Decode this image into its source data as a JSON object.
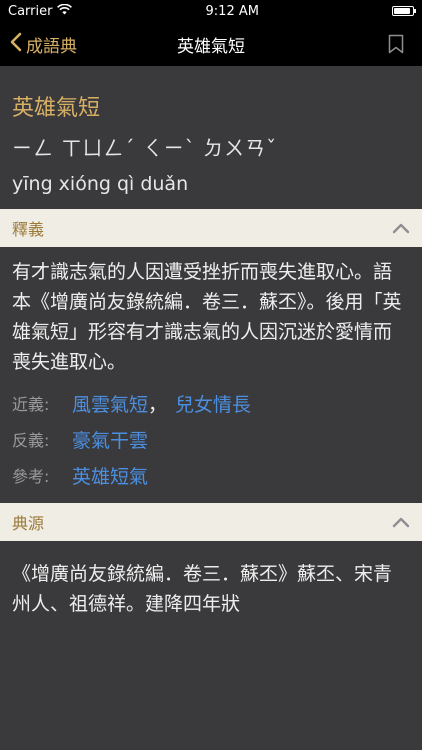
{
  "status": {
    "carrier": "Carrier",
    "time": "9:12 AM",
    "battery_level": 0.9
  },
  "nav": {
    "back_label": "成語典",
    "title": "英雄氣短"
  },
  "entry": {
    "title": "英雄氣短",
    "bopomofo": "ㄧㄥ ㄒㄩㄥˊ ㄑㄧˋ ㄉㄨㄢˇ",
    "pinyin": "yīng xióng qì duǎn"
  },
  "meaning": {
    "header": "釋義",
    "definition": "有才識志氣的人因遭受挫折而喪失進取心。語本《增廣尚友錄統編．卷三．蘇丕》。後用「英雄氣短」形容有才識志氣的人因沉迷於愛情而喪失進取心。",
    "synonyms_label": "近義:",
    "synonyms": [
      "風雲氣短",
      "兒女情長"
    ],
    "synonym_separator": "，",
    "antonyms_label": "反義:",
    "antonyms": [
      "豪氣干雲"
    ],
    "reference_label": "參考:",
    "references": [
      "英雄短氣"
    ]
  },
  "source": {
    "header": "典源",
    "text": "《增廣尚友錄統編．卷三．蘇丕》蘇丕、宋青州人、祖德祥。建降四年狀"
  },
  "colors": {
    "accent": "#d7b065",
    "link": "#4c8fe0",
    "background": "#3a3a3c",
    "section_header_bg": "#efede4"
  },
  "icons": {
    "back": "chevron-left-icon",
    "bookmark": "bookmark-icon",
    "collapse": "chevron-up-icon",
    "wifi": "wifi-icon",
    "battery": "battery-icon"
  }
}
